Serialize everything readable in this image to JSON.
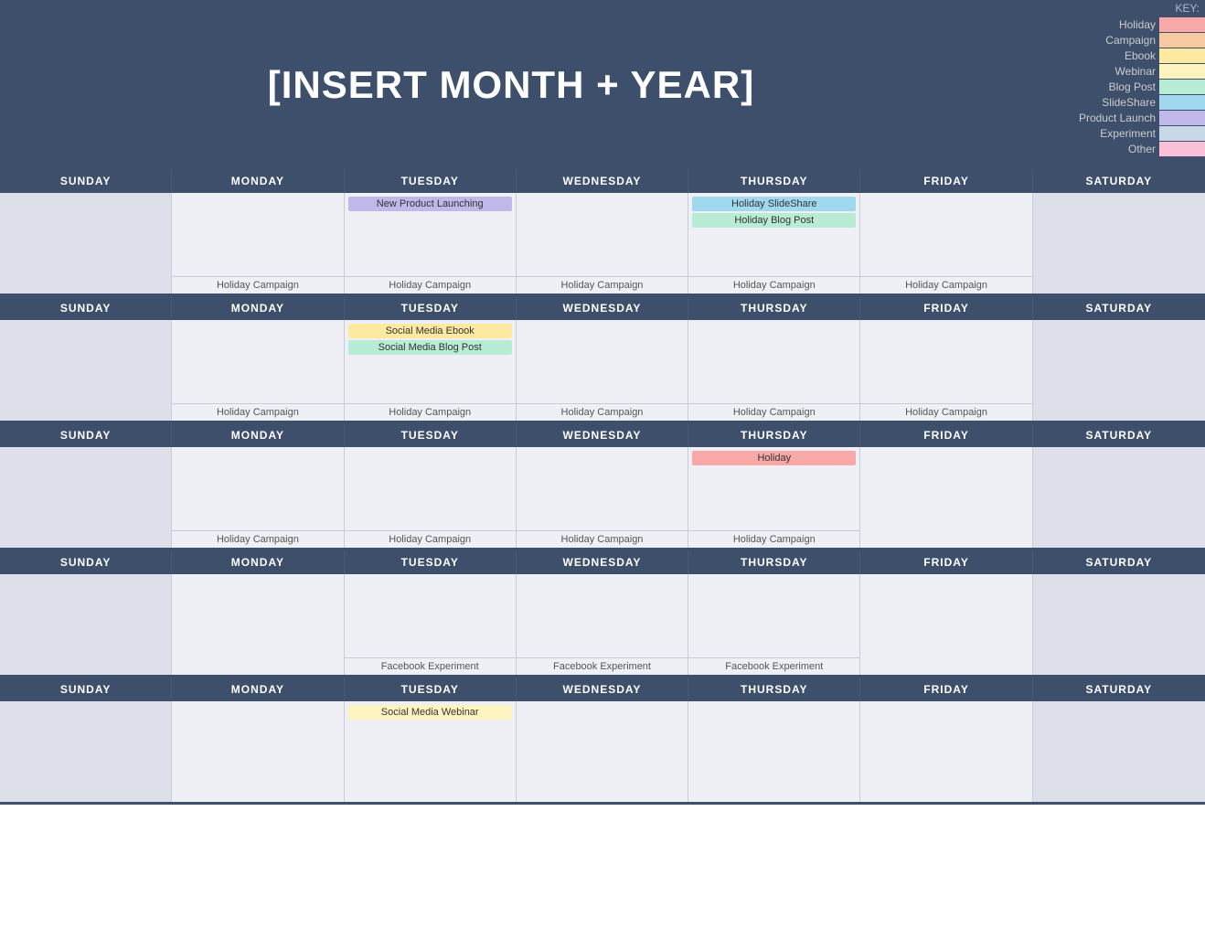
{
  "header": {
    "title": "[INSERT MONTH + YEAR]"
  },
  "key": {
    "label": "KEY:",
    "items": [
      {
        "name": "Holiday",
        "class": "sw-holiday"
      },
      {
        "name": "Campaign",
        "class": "sw-campaign"
      },
      {
        "name": "Ebook",
        "class": "sw-ebook"
      },
      {
        "name": "Webinar",
        "class": "sw-webinar"
      },
      {
        "name": "Blog Post",
        "class": "sw-blogpost"
      },
      {
        "name": "SlideShare",
        "class": "sw-slideshare"
      },
      {
        "name": "Product Launch",
        "class": "sw-productlaunch"
      },
      {
        "name": "Experiment",
        "class": "sw-experiment"
      },
      {
        "name": "Other",
        "class": "sw-other"
      }
    ]
  },
  "days": [
    "SUNDAY",
    "MONDAY",
    "TUESDAY",
    "WEDNESDAY",
    "THURSDAY",
    "FRIDAY",
    "SATURDAY"
  ],
  "weeks": [
    {
      "cells": [
        {
          "events": [],
          "footer": ""
        },
        {
          "events": [],
          "footer": "Holiday Campaign"
        },
        {
          "events": [
            {
              "label": "New Product Launching",
              "class": "ev-productlaunch"
            }
          ],
          "footer": "Holiday Campaign"
        },
        {
          "events": [],
          "footer": "Holiday Campaign"
        },
        {
          "events": [
            {
              "label": "Holiday SlideShare",
              "class": "ev-slideshare"
            },
            {
              "label": "Holiday Blog Post",
              "class": "ev-blogpost"
            }
          ],
          "footer": "Holiday Campaign"
        },
        {
          "events": [],
          "footer": "Holiday Campaign"
        },
        {
          "events": [],
          "footer": ""
        }
      ]
    },
    {
      "cells": [
        {
          "events": [],
          "footer": ""
        },
        {
          "events": [],
          "footer": "Holiday Campaign"
        },
        {
          "events": [
            {
              "label": "Social Media Ebook",
              "class": "ev-ebook"
            },
            {
              "label": "Social Media Blog Post",
              "class": "ev-blogpost"
            }
          ],
          "footer": "Holiday Campaign"
        },
        {
          "events": [],
          "footer": "Holiday Campaign"
        },
        {
          "events": [],
          "footer": "Holiday Campaign"
        },
        {
          "events": [],
          "footer": "Holiday Campaign"
        },
        {
          "events": [],
          "footer": ""
        }
      ]
    },
    {
      "cells": [
        {
          "events": [],
          "footer": ""
        },
        {
          "events": [],
          "footer": "Holiday Campaign"
        },
        {
          "events": [],
          "footer": "Holiday Campaign"
        },
        {
          "events": [],
          "footer": "Holiday Campaign"
        },
        {
          "events": [
            {
              "label": "Holiday",
              "class": "ev-holiday"
            }
          ],
          "footer": "Holiday Campaign"
        },
        {
          "events": [],
          "footer": ""
        },
        {
          "events": [],
          "footer": ""
        }
      ]
    },
    {
      "cells": [
        {
          "events": [],
          "footer": ""
        },
        {
          "events": [],
          "footer": ""
        },
        {
          "events": [],
          "footer": "Facebook Experiment"
        },
        {
          "events": [],
          "footer": "Facebook Experiment"
        },
        {
          "events": [],
          "footer": "Facebook Experiment"
        },
        {
          "events": [],
          "footer": ""
        },
        {
          "events": [],
          "footer": ""
        }
      ]
    },
    {
      "cells": [
        {
          "events": [],
          "footer": ""
        },
        {
          "events": [],
          "footer": ""
        },
        {
          "events": [
            {
              "label": "Social Media Webinar",
              "class": "ev-webinar"
            }
          ],
          "footer": ""
        },
        {
          "events": [],
          "footer": ""
        },
        {
          "events": [],
          "footer": ""
        },
        {
          "events": [],
          "footer": ""
        },
        {
          "events": [],
          "footer": ""
        }
      ]
    }
  ]
}
